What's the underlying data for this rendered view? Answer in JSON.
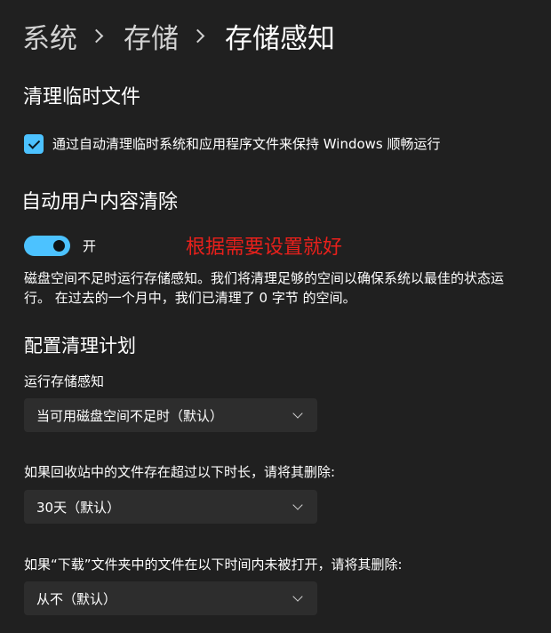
{
  "breadcrumb": {
    "items": [
      "系统",
      "存储"
    ],
    "current": "存储感知"
  },
  "temp_files": {
    "title": "清理临时文件",
    "checkbox_label": "通过自动清理临时系统和应用程序文件来保持 Windows 顺畅运行",
    "checked": true
  },
  "auto_cleanup": {
    "title": "自动用户内容清除",
    "toggle_label": "开",
    "toggle_on": true,
    "annotation": "根据需要设置就好",
    "annotation_color": "#e8201b",
    "description": "磁盘空间不足时运行存储感知。我们将清理足够的空间以确保系统以最佳的状态运行。 在过去的一个月中，我们已清理了 0 字节 的空间。"
  },
  "schedule": {
    "title": "配置清理计划",
    "run_label": "运行存储感知",
    "run_value": "当可用磁盘空间不足时（默认）",
    "recycle_label": "如果回收站中的文件存在超过以下时长，请将其删除:",
    "recycle_value": "30天（默认）",
    "downloads_label": "如果“下载”文件夹中的文件在以下时间内未被打开，请将其删除:",
    "downloads_value": "从不（默认）"
  },
  "colors": {
    "background": "#202020",
    "accent": "#4cc2ff",
    "dropdown_bg": "#2d2d2d"
  }
}
